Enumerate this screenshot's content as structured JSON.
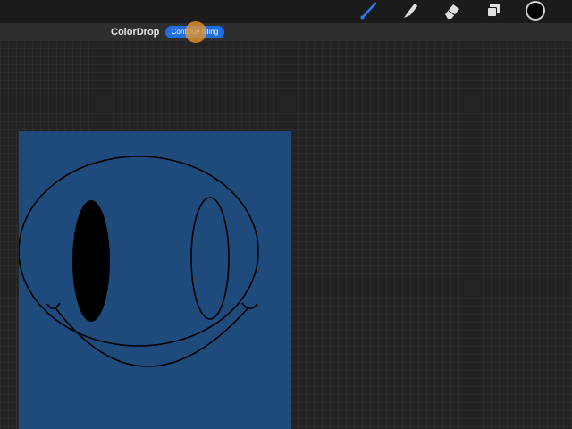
{
  "toolbar": {
    "tools": [
      {
        "name": "brush",
        "icon": "paintbrush-icon",
        "active": true,
        "color": "#2f7cf6"
      },
      {
        "name": "smudge",
        "icon": "smudge-finger-icon",
        "active": false,
        "color": "#e0e0e0"
      },
      {
        "name": "eraser",
        "icon": "eraser-icon",
        "active": false,
        "color": "#e0e0e0"
      },
      {
        "name": "layers",
        "icon": "layers-icon",
        "active": false,
        "color": "#e0e0e0"
      }
    ],
    "current_color": "#000000"
  },
  "notice": {
    "title": "ColorDrop",
    "button_label": "Continue filling",
    "button_color": "#1f6fe0"
  },
  "canvas": {
    "background_color": "#1f4a7c",
    "line_color": "#000000",
    "filled_eye_color": "#000000"
  }
}
